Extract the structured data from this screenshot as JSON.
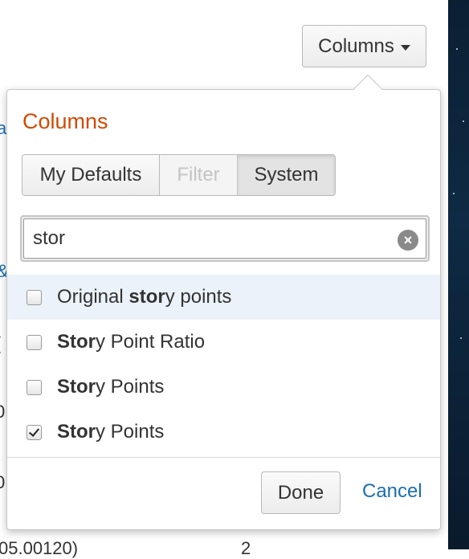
{
  "toolbar": {
    "columns_label": "Columns"
  },
  "popup": {
    "title": "Columns",
    "tabs": [
      {
        "label": "My Defaults",
        "state": "normal"
      },
      {
        "label": "Filter",
        "state": "disabled"
      },
      {
        "label": "System",
        "state": "selected"
      }
    ],
    "search": {
      "value": "stor",
      "placeholder": ""
    },
    "options": [
      {
        "pre": "Original ",
        "match": "stor",
        "post": "y points",
        "checked": false,
        "highlighted": true
      },
      {
        "pre": "",
        "match": "Stor",
        "post": "y Point Ratio",
        "checked": false,
        "highlighted": false
      },
      {
        "pre": "",
        "match": "Stor",
        "post": "y Points",
        "checked": false,
        "highlighted": false
      },
      {
        "pre": "",
        "match": "Stor",
        "post": "y Points",
        "checked": true,
        "highlighted": false
      }
    ],
    "done_label": "Done",
    "cancel_label": "Cancel"
  },
  "background": {
    "fragments": [
      "a",
      "&",
      "(",
      "0",
      "0",
      "05.00120)",
      "2"
    ]
  },
  "colors": {
    "title": "#d04a02",
    "link": "#1a6fb0",
    "highlight_row": "#ebf2f9"
  }
}
